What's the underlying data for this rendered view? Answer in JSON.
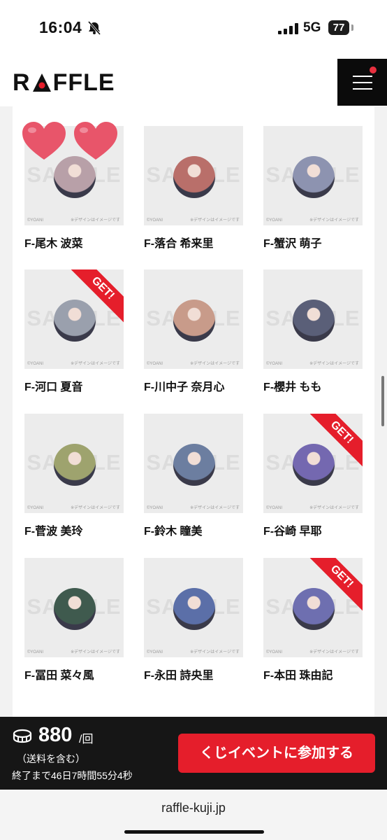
{
  "status_bar": {
    "time": "16:04",
    "network": "5G",
    "battery": "77"
  },
  "header": {
    "logo_text_1": "R",
    "logo_text_2": "FFLE"
  },
  "tile_watermark": "SAMPLE",
  "tile_copyright": "©YOANI",
  "tile_disclaimer": "※デザインはイメージです",
  "get_label": "GET!",
  "items": [
    {
      "label": "F-尾木 波菜",
      "photo_color": "#b8a0a8",
      "get": false
    },
    {
      "label": "F-落合 希来里",
      "photo_color": "#b96f6a",
      "get": false
    },
    {
      "label": "F-蟹沢 萌子",
      "photo_color": "#8d93b0",
      "get": false
    },
    {
      "label": "F-河口 夏音",
      "photo_color": "#9aa0ad",
      "get": true
    },
    {
      "label": "F-川中子 奈月心",
      "photo_color": "#c89b8a",
      "get": false
    },
    {
      "label": "F-櫻井 もも",
      "photo_color": "#5a5f78",
      "get": false
    },
    {
      "label": "F-菅波 美玲",
      "photo_color": "#9ea36e",
      "get": false
    },
    {
      "label": "F-鈴木 瞳美",
      "photo_color": "#6c7ea0",
      "get": false
    },
    {
      "label": "F-谷崎 早耶",
      "photo_color": "#7468b0",
      "get": true
    },
    {
      "label": "F-冨田 菜々風",
      "photo_color": "#3f5a4e",
      "get": false
    },
    {
      "label": "F-永田 詩央里",
      "photo_color": "#5b6fa8",
      "get": false
    },
    {
      "label": "F-本田 珠由記",
      "photo_color": "#6e6fb0",
      "get": true
    }
  ],
  "purchase": {
    "price": "880",
    "unit": "/回",
    "shipping_note": "（送料を含む）",
    "time_left": "終了まで46日7時間55分4秒",
    "join_button": "くじイベントに参加する"
  },
  "browser": {
    "url": "raffle-kuji.jp"
  },
  "colors": {
    "accent": "#e51e2b",
    "bar": "#161616"
  }
}
